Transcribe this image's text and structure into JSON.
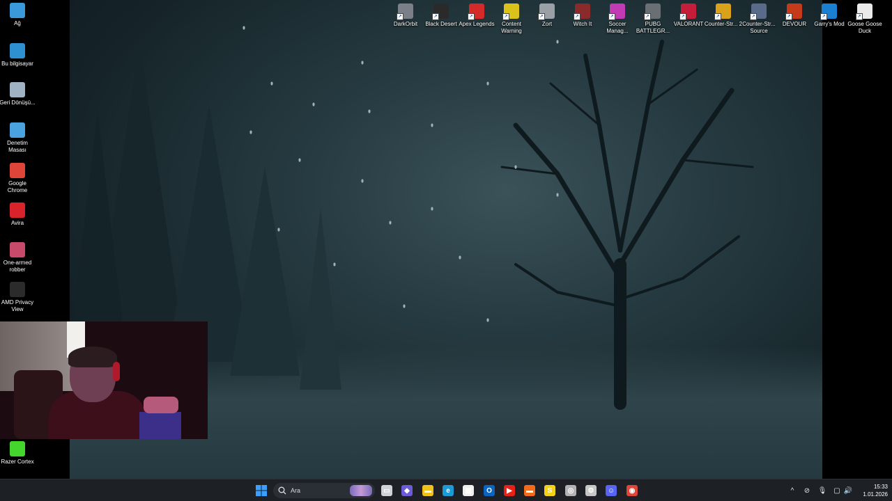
{
  "desktop_left": [
    {
      "label": "Ağ",
      "icon": "network-icon",
      "color": "#3a9ad9"
    },
    {
      "label": "Bu bilgisayar",
      "icon": "computer-icon",
      "color": "#2e8fd1"
    },
    {
      "label": "Geri Dönüşü...",
      "icon": "recycle-bin-icon",
      "color": "#9fb3c4"
    },
    {
      "label": "Denetim Masası",
      "icon": "control-panel-icon",
      "color": "#4aa3df"
    },
    {
      "label": "Google Chrome",
      "icon": "chrome-icon",
      "color": "#e0453a"
    },
    {
      "label": "Avira",
      "icon": "avira-icon",
      "color": "#d8232a"
    },
    {
      "label": "One-armed robber",
      "icon": "slot-machine-icon",
      "color": "#c74a6a"
    },
    {
      "label": "AMD Privacy View",
      "icon": "amd-privacy-icon",
      "color": "#2b2b2b"
    },
    {
      "label": "Razer Cortex",
      "icon": "razer-cortex-icon",
      "color": "#44d62c"
    }
  ],
  "desktop_top": [
    {
      "label": "DarkOrbit",
      "icon": "darkorbit-icon",
      "color": "#7a7f88"
    },
    {
      "label": "Black Desert",
      "icon": "black-desert-icon",
      "color": "#2a2a2a"
    },
    {
      "label": "Apex Legends",
      "icon": "apex-icon",
      "color": "#d42a2a"
    },
    {
      "label": "Content Warning",
      "icon": "content-warning-icon",
      "color": "#d9c21a"
    },
    {
      "label": "Zort",
      "icon": "zort-icon",
      "color": "#9aa0a6"
    },
    {
      "label": "Witch It",
      "icon": "witch-it-icon",
      "color": "#8a2a2a"
    },
    {
      "label": "Soccer Manag...",
      "icon": "soccer-manager-icon",
      "color": "#c23bb5"
    },
    {
      "label": "PUBG BATTLEGR...",
      "icon": "pubg-icon",
      "color": "#6a6f74"
    },
    {
      "label": "VALORANT",
      "icon": "valorant-icon",
      "color": "#c41e3a"
    },
    {
      "label": "Counter-Str... 2",
      "icon": "cs2-icon",
      "color": "#d9a21a"
    },
    {
      "label": "Counter-Str... Source",
      "icon": "cs-source-icon",
      "color": "#5a6b8a"
    },
    {
      "label": "DEVOUR",
      "icon": "devour-icon",
      "color": "#c43a1a"
    },
    {
      "label": "Garry's Mod",
      "icon": "garrys-mod-icon",
      "color": "#1a7fd1"
    },
    {
      "label": "Goose Goose Duck",
      "icon": "goose-goose-duck-icon",
      "color": "#eaeaea"
    }
  ],
  "taskbar": {
    "search_placeholder": "Ara",
    "apps": [
      {
        "name": "task-view-icon",
        "color": "#cfd3d8",
        "glyph": "▭"
      },
      {
        "name": "copilot-icon",
        "color": "#6b5bd6",
        "glyph": "◆"
      },
      {
        "name": "file-explorer-icon",
        "color": "#f2c21b",
        "glyph": "▬"
      },
      {
        "name": "edge-icon",
        "color": "#1b9ad6",
        "glyph": "e"
      },
      {
        "name": "microsoft-store-icon",
        "color": "#f0f0f0",
        "glyph": "▦"
      },
      {
        "name": "outlook-icon",
        "color": "#0a64c2",
        "glyph": "O"
      },
      {
        "name": "youtube-icon",
        "color": "#e62117",
        "glyph": "▶"
      },
      {
        "name": "orange-app-icon",
        "color": "#f26b1d",
        "glyph": "▬"
      },
      {
        "name": "s-app-icon",
        "color": "#f5d21a",
        "glyph": "S"
      },
      {
        "name": "racing-app-icon",
        "color": "#b3b3b3",
        "glyph": "◎"
      },
      {
        "name": "steam-icon",
        "color": "#c7c7c7",
        "glyph": "⚙"
      },
      {
        "name": "discord-icon",
        "color": "#5865f2",
        "glyph": "☺"
      },
      {
        "name": "chrome-taskbar-icon",
        "color": "#e0453a",
        "glyph": "◉"
      }
    ],
    "time": "15:33",
    "date": "1.01.2026"
  }
}
